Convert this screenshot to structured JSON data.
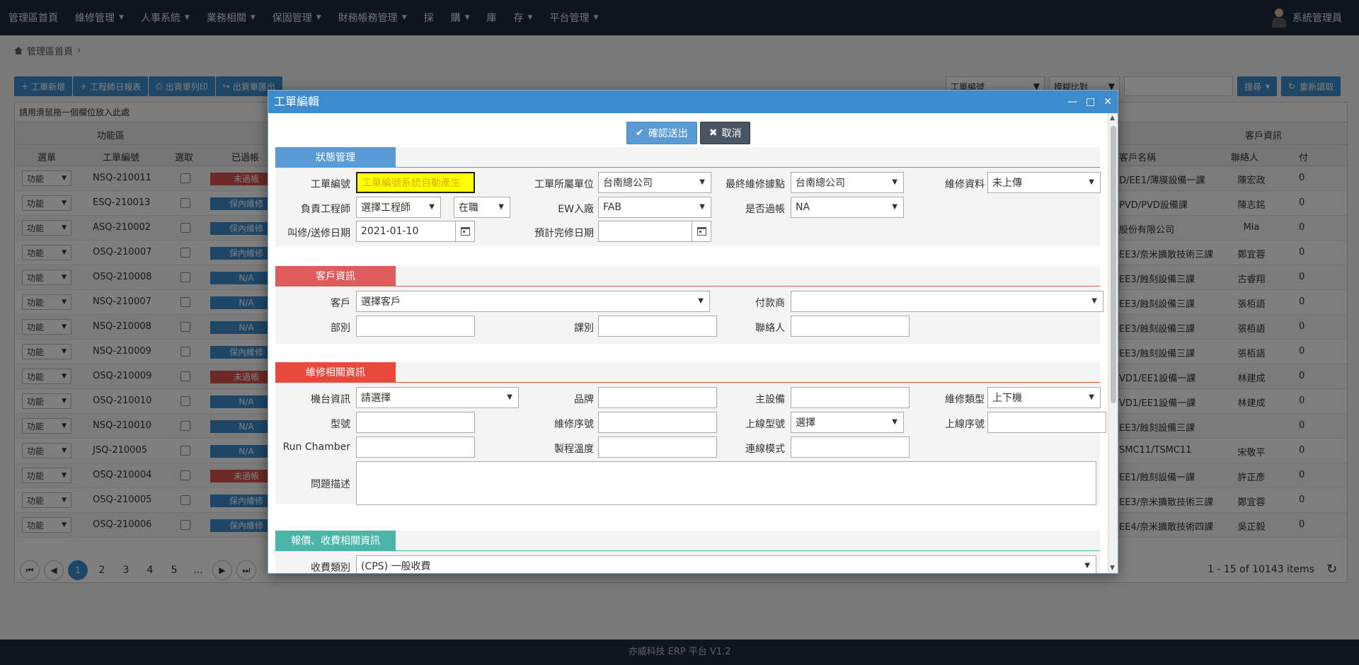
{
  "nav": {
    "items": [
      {
        "label": "管理區首頁",
        "caret": false
      },
      {
        "label": "維修管理",
        "caret": true
      },
      {
        "label": "人事系統",
        "caret": true
      },
      {
        "label": "業務相關",
        "caret": true
      },
      {
        "label": "保固管理",
        "caret": true
      },
      {
        "label": "財務帳務管理",
        "caret": true
      },
      {
        "label": "採",
        "caret": false
      },
      {
        "label": "購",
        "caret": true
      },
      {
        "label": "庫",
        "caret": false
      },
      {
        "label": "存",
        "caret": true
      },
      {
        "label": "平台管理",
        "caret": true
      }
    ],
    "user": "系統管理員"
  },
  "breadcrumb": {
    "home": "管理區首頁",
    "sep": "›"
  },
  "toolbar": {
    "buttons": [
      "工單新增",
      "工程師日報表",
      "出貨單列印",
      "出貨單匯出"
    ],
    "field_select": "工單編號",
    "mode_select": "模糊比對",
    "search_label": "搜尋",
    "reload_label": "重新讀取"
  },
  "grid": {
    "hint": "請用滑鼠拖一個欄位放入此處",
    "group_left": "功能區",
    "group_right": "客戶資訊",
    "headers": {
      "fn": "選單",
      "id": "工單編號",
      "pick": "選取",
      "passed": "已過帳",
      "cust": "客戶名稱",
      "contact": "聯絡人",
      "paid": "付"
    },
    "fn_label": "功能",
    "rows": [
      {
        "id": "NSQ-210011",
        "status": "未過帳",
        "color": "#d9534f",
        "cust": "D/EE1/薄膜設備一課",
        "contact": "陳宏政",
        "paid": "0"
      },
      {
        "id": "ESQ-210013",
        "status": "保內維修",
        "color": "#3c8ccd",
        "cust": "PVD/PVD設備課",
        "contact": "陳志銘",
        "paid": "0"
      },
      {
        "id": "ASQ-210002",
        "status": "保內維修",
        "color": "#3c8ccd",
        "cust": "股份有限公司",
        "contact": "Mia",
        "paid": "0"
      },
      {
        "id": "OSQ-210007",
        "status": "保內維修",
        "color": "#3c8ccd",
        "cust": "EE3/奈米擴散技術三課",
        "contact": "鄭宜蓉",
        "paid": "0"
      },
      {
        "id": "OSQ-210008",
        "status": "N/A",
        "color": "#3c8ccd",
        "cust": "EE3/蝕刻設備三課",
        "contact": "古睿翔",
        "paid": "0"
      },
      {
        "id": "NSQ-210007",
        "status": "N/A",
        "color": "#3c8ccd",
        "cust": "EE3/蝕刻設備三課",
        "contact": "張栢語",
        "paid": "0"
      },
      {
        "id": "NSQ-210008",
        "status": "N/A",
        "color": "#3c8ccd",
        "cust": "EE3/蝕刻設備三課",
        "contact": "張栢語",
        "paid": "0"
      },
      {
        "id": "NSQ-210009",
        "status": "保內維修",
        "color": "#3c8ccd",
        "cust": "EE3/蝕刻設備三課",
        "contact": "張栢語",
        "paid": "0"
      },
      {
        "id": "OSQ-210009",
        "status": "未過帳",
        "color": "#d9534f",
        "cust": "VD1/EE1設備一課",
        "contact": "林建成",
        "paid": "0"
      },
      {
        "id": "OSQ-210010",
        "status": "N/A",
        "color": "#3c8ccd",
        "cust": "VD1/EE1設備一課",
        "contact": "林建成",
        "paid": "0"
      },
      {
        "id": "NSQ-210010",
        "status": "N/A",
        "color": "#3c8ccd",
        "cust": "EE3/蝕刻設備三課",
        "contact": "",
        "paid": "0"
      },
      {
        "id": "JSQ-210005",
        "status": "N/A",
        "color": "#3c8ccd",
        "cust": "SMC11/TSMC11",
        "contact": "宋敬平",
        "paid": "0"
      },
      {
        "id": "OSQ-210004",
        "status": "未過帳",
        "color": "#d9534f",
        "cust": "EE1/蝕刻設備一課",
        "contact": "許正彥",
        "paid": "0"
      },
      {
        "id": "OSQ-210005",
        "status": "保內維修",
        "color": "#3c8ccd",
        "cust": "EE3/奈米擴散技術三課",
        "contact": "鄭宜蓉",
        "paid": "0"
      },
      {
        "id": "OSQ-210006",
        "status": "保內維修",
        "color": "#3c8ccd",
        "cust": "EE4/奈米擴散技術四課",
        "contact": "吳正毅",
        "paid": "0"
      }
    ]
  },
  "pager": {
    "pages": [
      "1",
      "2",
      "3",
      "4",
      "5",
      "..."
    ],
    "current": "1",
    "summary": "1 - 15 of 10143 items"
  },
  "footer": "亦威科技 ERP 平台 V1.2",
  "dialog": {
    "title": "工單編輯",
    "confirm": "確認送出",
    "cancel": "取消",
    "sections": {
      "status": {
        "title": "狀態管理",
        "color": "#5b9bd5"
      },
      "customer": {
        "title": "客戶資訊",
        "color": "#e05b5b"
      },
      "repair": {
        "title": "維修相關資訊",
        "color": "#e8493c"
      },
      "quote": {
        "title": "報價、收費相關資訊",
        "color": "#4bb5a8"
      }
    },
    "status_fields": {
      "order_no_label": "工單編號",
      "order_no_value": "工單編號系統自動產生",
      "unit_label": "工單所屬單位",
      "unit_value": "台南總公司",
      "final_point_label": "最終維修據點",
      "final_point_value": "台南總公司",
      "repair_data_label": "維修資料",
      "repair_data_value": "未上傳",
      "engineer_label": "負責工程師",
      "engineer_value": "選擇工程師",
      "engineer_state": "在職",
      "ew_label": "EW入廠",
      "ew_value": "FAB",
      "posted_label": "是否過帳",
      "posted_value": "NA",
      "call_date_label": "叫修/送修日期",
      "call_date_value": "2021-01-10",
      "est_date_label": "預計完修日期",
      "est_date_value": ""
    },
    "customer_fields": {
      "customer_label": "客戶",
      "customer_value": "選擇客戶",
      "payer_label": "付款商",
      "payer_value": "",
      "dept_label": "部別",
      "section_label": "課別",
      "contact_label": "聯絡人"
    },
    "repair_fields": {
      "machine_label": "機台資訊",
      "machine_value": "請選擇",
      "brand_label": "品牌",
      "main_equip_label": "主設備",
      "repair_type_label": "維修類型",
      "repair_type_value": "上下機",
      "model_label": "型號",
      "repair_seq_label": "維修序號",
      "online_model_label": "上線型號",
      "online_model_value": "選擇",
      "online_seq_label": "上線序號",
      "chamber_label": "Run Chamber",
      "process_temp_label": "製程溫度",
      "link_mode_label": "連線模式",
      "issue_label": "問題描述"
    },
    "quote_fields": {
      "fee_type_label": "收費類別",
      "fee_type_value": "(CPS) 一般收費"
    }
  }
}
